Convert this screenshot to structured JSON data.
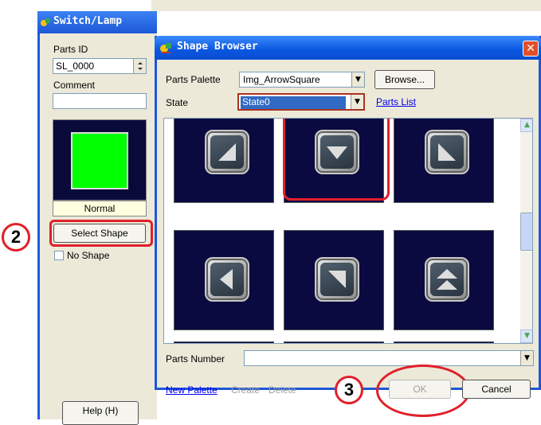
{
  "switch_lamp": {
    "title": "Switch/Lamp",
    "parts_id_label": "Parts ID",
    "parts_id_value": "SL_0000",
    "comment_label": "Comment",
    "comment_value": "",
    "preview_state": "Normal",
    "preview_color": "#00ff00",
    "select_shape_label": "Select Shape",
    "no_shape_label": "No Shape",
    "help_label": "Help (H)"
  },
  "markers": {
    "step2": "2",
    "step3": "3"
  },
  "shape_browser": {
    "title": "Shape Browser",
    "close_label": "✕",
    "parts_palette_label": "Parts Palette",
    "parts_palette_value": "Img_ArrowSquare",
    "browse_label": "Browse...",
    "state_label": "State",
    "state_value": "State0",
    "parts_list_link": "Parts List",
    "parts_number_label": "Parts Number",
    "parts_number_value": "",
    "new_palette_link": "New Palette",
    "create_label": "Create",
    "delete_label": "Delete",
    "ok_label": "OK",
    "cancel_label": "Cancel",
    "tiles": [
      {
        "name": "arrow-down-left",
        "selected": false
      },
      {
        "name": "arrow-down",
        "selected": true
      },
      {
        "name": "arrow-down-right",
        "selected": false
      },
      {
        "name": "arrow-left",
        "selected": false
      },
      {
        "name": "arrow-up-left",
        "selected": false
      },
      {
        "name": "arrow-up-double",
        "selected": false
      }
    ]
  },
  "colors": {
    "accent_ring": "#e0202a",
    "tile_bg": "#0a0a40",
    "title_bar": "#1d57d8"
  }
}
